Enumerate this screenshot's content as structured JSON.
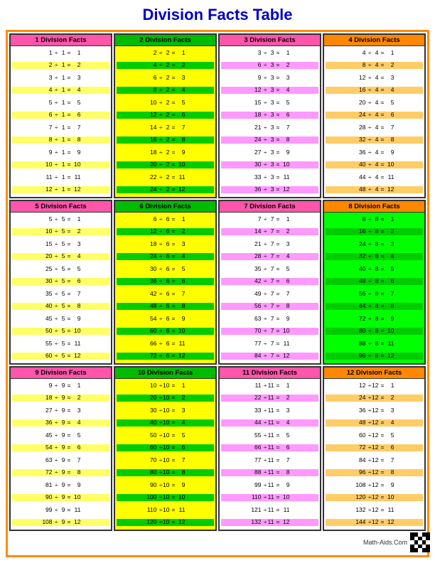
{
  "title": "Division Facts Table",
  "sections": [
    {
      "id": 1,
      "label": "1 Division Facts",
      "divisor": 1,
      "headerBg": "#ff55aa",
      "bodyBg": "#ffffff",
      "altBg": "#ffff66",
      "rows": [
        "1 ÷ 1 = 1",
        "2 ÷ 1 = 2",
        "3 ÷ 1 = 3",
        "4 ÷ 1 = 4",
        "5 ÷ 1 = 5",
        "6 ÷ 1 = 6",
        "7 ÷ 1 = 7",
        "8 ÷ 1 = 8",
        "9 ÷ 1 = 9",
        "10 ÷ 1 = 10",
        "11 ÷ 1 = 11",
        "12 ÷ 1 = 12"
      ]
    },
    {
      "id": 2,
      "label": "2 Division Facts",
      "divisor": 2,
      "headerBg": "#00bb00",
      "bodyBg": "#ffff00",
      "altBg": "#00cc00",
      "rows": [
        "2 ÷ 2 = 1",
        "4 ÷ 2 = 2",
        "6 ÷ 2 = 3",
        "8 ÷ 2 = 4",
        "10 ÷ 2 = 5",
        "12 ÷ 2 = 6",
        "14 ÷ 2 = 7",
        "16 ÷ 2 = 8",
        "18 ÷ 2 = 9",
        "20 ÷ 2 = 10",
        "22 ÷ 2 = 11",
        "24 ÷ 2 = 12"
      ]
    },
    {
      "id": 3,
      "label": "3 Division Facts",
      "divisor": 3,
      "headerBg": "#ff55aa",
      "bodyBg": "#ffffff",
      "altBg": "#ff99ff",
      "rows": [
        "3 ÷ 3 = 1",
        "6 ÷ 3 = 2",
        "9 ÷ 3 = 3",
        "12 ÷ 3 = 4",
        "15 ÷ 3 = 5",
        "18 ÷ 3 = 6",
        "21 ÷ 3 = 7",
        "24 ÷ 3 = 8",
        "27 ÷ 3 = 9",
        "30 ÷ 3 = 10",
        "33 ÷ 3 = 11",
        "36 ÷ 3 = 12"
      ]
    },
    {
      "id": 4,
      "label": "4 Division Facts",
      "divisor": 4,
      "headerBg": "#ff8800",
      "bodyBg": "#ffffff",
      "altBg": "#ffcc66",
      "rows": [
        "4 ÷ 4 = 1",
        "8 ÷ 4 = 2",
        "12 ÷ 4 = 3",
        "16 ÷ 4 = 4",
        "20 ÷ 4 = 5",
        "24 ÷ 4 = 6",
        "28 ÷ 4 = 7",
        "32 ÷ 4 = 8",
        "36 ÷ 4 = 9",
        "40 ÷ 4 = 10",
        "44 ÷ 4 = 11",
        "48 ÷ 4 = 12"
      ]
    },
    {
      "id": 5,
      "label": "5 Division Facts",
      "divisor": 5,
      "headerBg": "#ff55aa",
      "bodyBg": "#ffffff",
      "altBg": "#ffff66",
      "rows": [
        "5 ÷ 5 = 1",
        "10 ÷ 5 = 2",
        "15 ÷ 5 = 3",
        "20 ÷ 5 = 4",
        "25 ÷ 5 = 5",
        "30 ÷ 5 = 6",
        "35 ÷ 5 = 7",
        "40 ÷ 5 = 8",
        "45 ÷ 5 = 9",
        "50 ÷ 5 = 10",
        "55 ÷ 5 = 11",
        "60 ÷ 5 = 12"
      ]
    },
    {
      "id": 6,
      "label": "6 Division Facts",
      "divisor": 6,
      "headerBg": "#00bb00",
      "bodyBg": "#ffff00",
      "altBg": "#00cc00",
      "rows": [
        "6 ÷ 6 = 1",
        "12 ÷ 6 = 2",
        "18 ÷ 6 = 3",
        "24 ÷ 6 = 4",
        "30 ÷ 6 = 5",
        "36 ÷ 6 = 6",
        "42 ÷ 6 = 7",
        "48 ÷ 6 = 8",
        "54 ÷ 6 = 9",
        "60 ÷ 6 = 10",
        "66 ÷ 6 = 11",
        "72 ÷ 6 = 12"
      ]
    },
    {
      "id": 7,
      "label": "7 Division Facts",
      "divisor": 7,
      "headerBg": "#ff55aa",
      "bodyBg": "#ffffff",
      "altBg": "#ff99ff",
      "rows": [
        "7 ÷ 7 = 1",
        "14 ÷ 7 = 2",
        "21 ÷ 7 = 3",
        "28 ÷ 7 = 4",
        "35 ÷ 7 = 5",
        "42 ÷ 7 = 6",
        "49 ÷ 7 = 7",
        "56 ÷ 7 = 8",
        "63 ÷ 7 = 9",
        "70 ÷ 7 = 10",
        "77 ÷ 7 = 11",
        "84 ÷ 7 = 12"
      ]
    },
    {
      "id": 8,
      "label": "8 Division Facts",
      "divisor": 8,
      "headerBg": "#ff8800",
      "bodyBg": "#00ff00",
      "altBg": "#00cc00",
      "rows": [
        "8 ÷ 8 = 1",
        "16 ÷ 8 = 2",
        "24 ÷ 8 = 3",
        "32 ÷ 8 = 4",
        "40 ÷ 8 = 5",
        "48 ÷ 8 = 6",
        "56 ÷ 8 = 7",
        "64 ÷ 8 = 8",
        "72 ÷ 8 = 9",
        "80 ÷ 8 = 10",
        "88 ÷ 8 = 11",
        "96 ÷ 8 = 12"
      ]
    },
    {
      "id": 9,
      "label": "9 Division Facts",
      "divisor": 9,
      "headerBg": "#ff55aa",
      "bodyBg": "#ffffff",
      "altBg": "#ffff66",
      "rows": [
        "9 ÷ 9 = 1",
        "18 ÷ 9 = 2",
        "27 ÷ 9 = 3",
        "36 ÷ 9 = 4",
        "45 ÷ 9 = 5",
        "54 ÷ 9 = 6",
        "63 ÷ 9 = 7",
        "72 ÷ 9 = 8",
        "81 ÷ 9 = 9",
        "90 ÷ 9 = 10",
        "99 ÷ 9 = 11",
        "108 ÷ 9 = 12"
      ]
    },
    {
      "id": 10,
      "label": "10 Division Facts",
      "divisor": 10,
      "headerBg": "#00bb00",
      "bodyBg": "#ffff00",
      "altBg": "#00cc00",
      "rows": [
        "10 ÷ 10 = 1",
        "20 ÷ 10 = 2",
        "30 ÷ 10 = 3",
        "40 ÷ 10 = 4",
        "50 ÷ 10 = 5",
        "60 ÷ 10 = 6",
        "70 ÷ 10 = 7",
        "80 ÷ 10 = 8",
        "90 ÷ 10 = 9",
        "100 ÷ 10 = 10",
        "110 ÷ 10 = 11",
        "120 ÷ 10 = 12"
      ]
    },
    {
      "id": 11,
      "label": "11 Division Facts",
      "divisor": 11,
      "headerBg": "#ff55aa",
      "bodyBg": "#ffffff",
      "altBg": "#ff99ff",
      "rows": [
        "11 ÷ 11 = 1",
        "22 ÷ 11 = 2",
        "33 ÷ 11 = 3",
        "44 ÷ 11 = 4",
        "55 ÷ 11 = 5",
        "66 ÷ 11 = 6",
        "77 ÷ 11 = 7",
        "88 ÷ 11 = 8",
        "99 ÷ 11 = 9",
        "110 ÷ 11 = 10",
        "121 ÷ 11 = 11",
        "132 ÷ 11 = 12"
      ]
    },
    {
      "id": 12,
      "label": "12 Division Facts",
      "divisor": 12,
      "headerBg": "#ff8800",
      "bodyBg": "#ffffff",
      "altBg": "#ffcc66",
      "rows": [
        "12 ÷ 12 = 1",
        "24 ÷ 12 = 2",
        "36 ÷ 12 = 3",
        "48 ÷ 12 = 4",
        "60 ÷ 12 = 5",
        "72 ÷ 12 = 6",
        "84 ÷ 12 = 7",
        "96 ÷ 12 = 8",
        "108 ÷ 12 = 9",
        "120 ÷ 12 = 10",
        "132 ÷ 12 = 11",
        "144 ÷ 12 = 12"
      ]
    }
  ],
  "footer": {
    "brand": "Math-Aids.Com"
  }
}
